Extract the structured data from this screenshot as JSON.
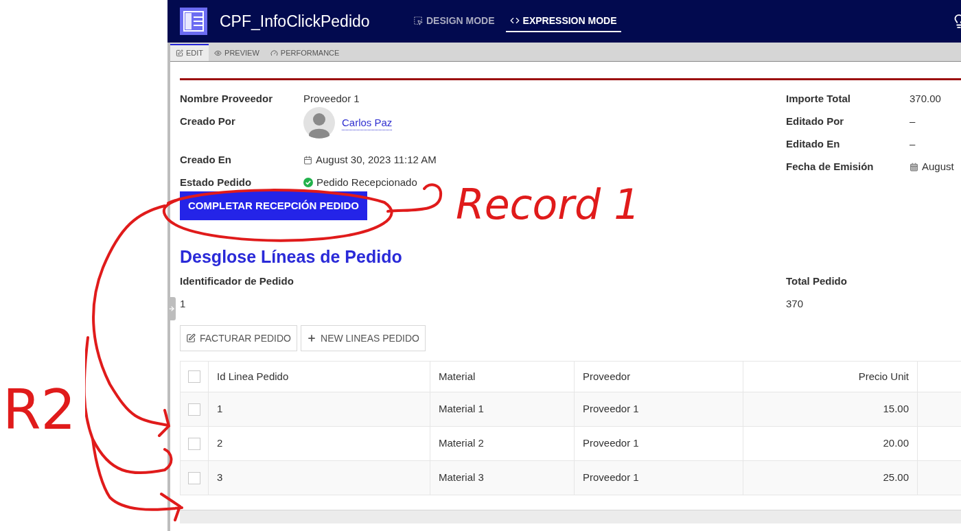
{
  "app": {
    "title": "CPF_InfoClickPedido",
    "modes": [
      {
        "label": "DESIGN MODE",
        "kind": "design",
        "selected": false
      },
      {
        "label": "EXPRESSION MODE",
        "kind": "expression",
        "selected": true
      }
    ]
  },
  "editor_tabs": [
    {
      "label": "EDIT",
      "kind": "edit",
      "selected": true
    },
    {
      "label": "PREVIEW",
      "kind": "preview",
      "selected": false
    },
    {
      "label": "PERFORMANCE",
      "kind": "performance",
      "selected": false
    }
  ],
  "details_left": [
    {
      "label": "Nombre Proveedor",
      "value": "Proveedor 1",
      "kind": "text"
    },
    {
      "label": "Creado Por",
      "value": "Carlos Paz",
      "kind": "user"
    },
    {
      "label": "Creado En",
      "value": "August 30, 2023 11:12 AM",
      "kind": "datetime"
    },
    {
      "label": "Estado Pedido",
      "value": "Pedido Recepcionado",
      "kind": "status"
    }
  ],
  "details_right": [
    {
      "label": "Importe Total",
      "value": "370.00",
      "kind": "text"
    },
    {
      "label": "Editado Por",
      "value": "–",
      "kind": "text"
    },
    {
      "label": "Editado En",
      "value": "–",
      "kind": "text"
    },
    {
      "label": "Fecha de Emisión",
      "value": "August",
      "kind": "date"
    }
  ],
  "primary_button": "COMPLETAR RECEPCIÓN PEDIDO",
  "lines": {
    "title": "Desglose Líneas de Pedido",
    "fields": [
      {
        "label": "Identificador de Pedido",
        "value": "1"
      },
      {
        "label": "Total Pedido",
        "value": "370"
      }
    ],
    "buttons": [
      {
        "label": "FACTURAR PEDIDO",
        "kind": "edit"
      },
      {
        "label": "NEW LINEAS PEDIDO",
        "kind": "add"
      }
    ],
    "table": {
      "all_checked": false,
      "columns": [
        {
          "label": "Id Linea Pedido",
          "kind": "text"
        },
        {
          "label": "Material",
          "kind": "text"
        },
        {
          "label": "Proveedor",
          "kind": "text"
        },
        {
          "label": "Precio Unit",
          "kind": "number"
        }
      ],
      "rows": [
        {
          "checked": false,
          "cells": [
            "1",
            "Material 1",
            "Proveedor 1",
            "15.00"
          ]
        },
        {
          "checked": false,
          "cells": [
            "2",
            "Material 2",
            "Proveedor 1",
            "20.00"
          ]
        },
        {
          "checked": false,
          "cells": [
            "3",
            "Material 3",
            "Proveedor 1",
            "25.00"
          ]
        }
      ]
    }
  },
  "annotations": [
    {
      "text": "Record 1"
    },
    {
      "text": "R2"
    }
  ]
}
